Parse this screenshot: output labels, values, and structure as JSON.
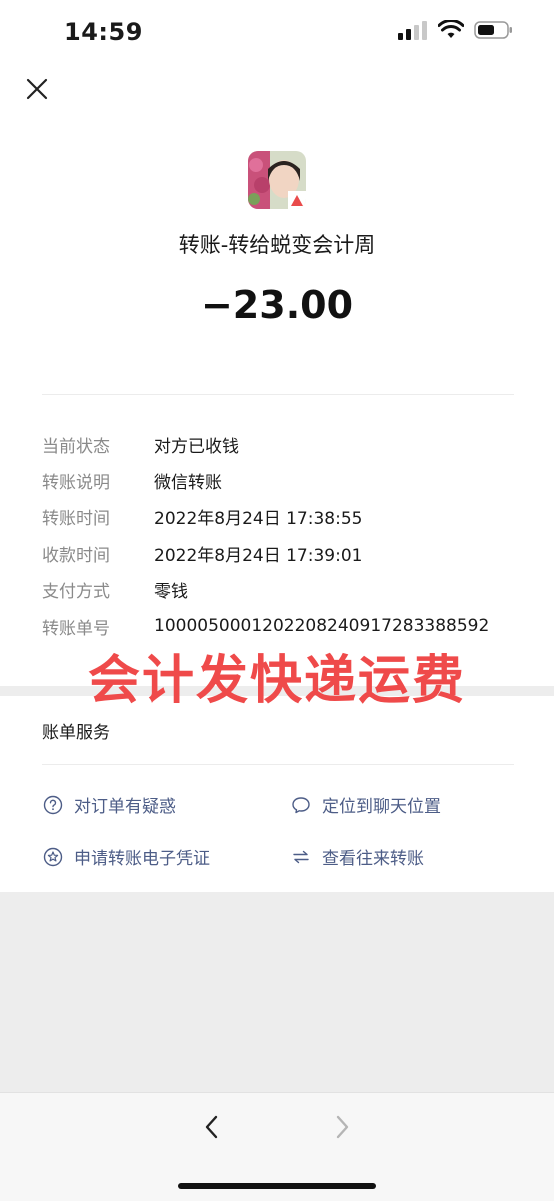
{
  "status_bar": {
    "time": "14:59"
  },
  "header": {
    "close_icon": "close-icon"
  },
  "transfer": {
    "title": "转账-转给蜕变会计周",
    "amount": "−23.00"
  },
  "details": [
    {
      "label": "当前状态",
      "value": "对方已收钱"
    },
    {
      "label": "转账说明",
      "value": "微信转账"
    },
    {
      "label": "转账时间",
      "value": "2022年8月24日 17:38:55"
    },
    {
      "label": "收款时间",
      "value": "2022年8月24日 17:39:01"
    },
    {
      "label": "支付方式",
      "value": "零钱"
    },
    {
      "label": "转账单号",
      "value": "1000050001202208240917283388592"
    }
  ],
  "watermark": "会计发快递运费",
  "services": {
    "title": "账单服务",
    "items": [
      {
        "label": "对订单有疑惑",
        "icon": "question-circle-icon"
      },
      {
        "label": "定位到聊天位置",
        "icon": "chat-bubble-icon"
      },
      {
        "label": "申请转账电子凭证",
        "icon": "star-circle-icon"
      },
      {
        "label": "查看往来转账",
        "icon": "exchange-arrows-icon"
      }
    ]
  },
  "colors": {
    "link": "#4d5d87",
    "watermark": "#ef4a4a",
    "label": "#8a8a8a"
  }
}
